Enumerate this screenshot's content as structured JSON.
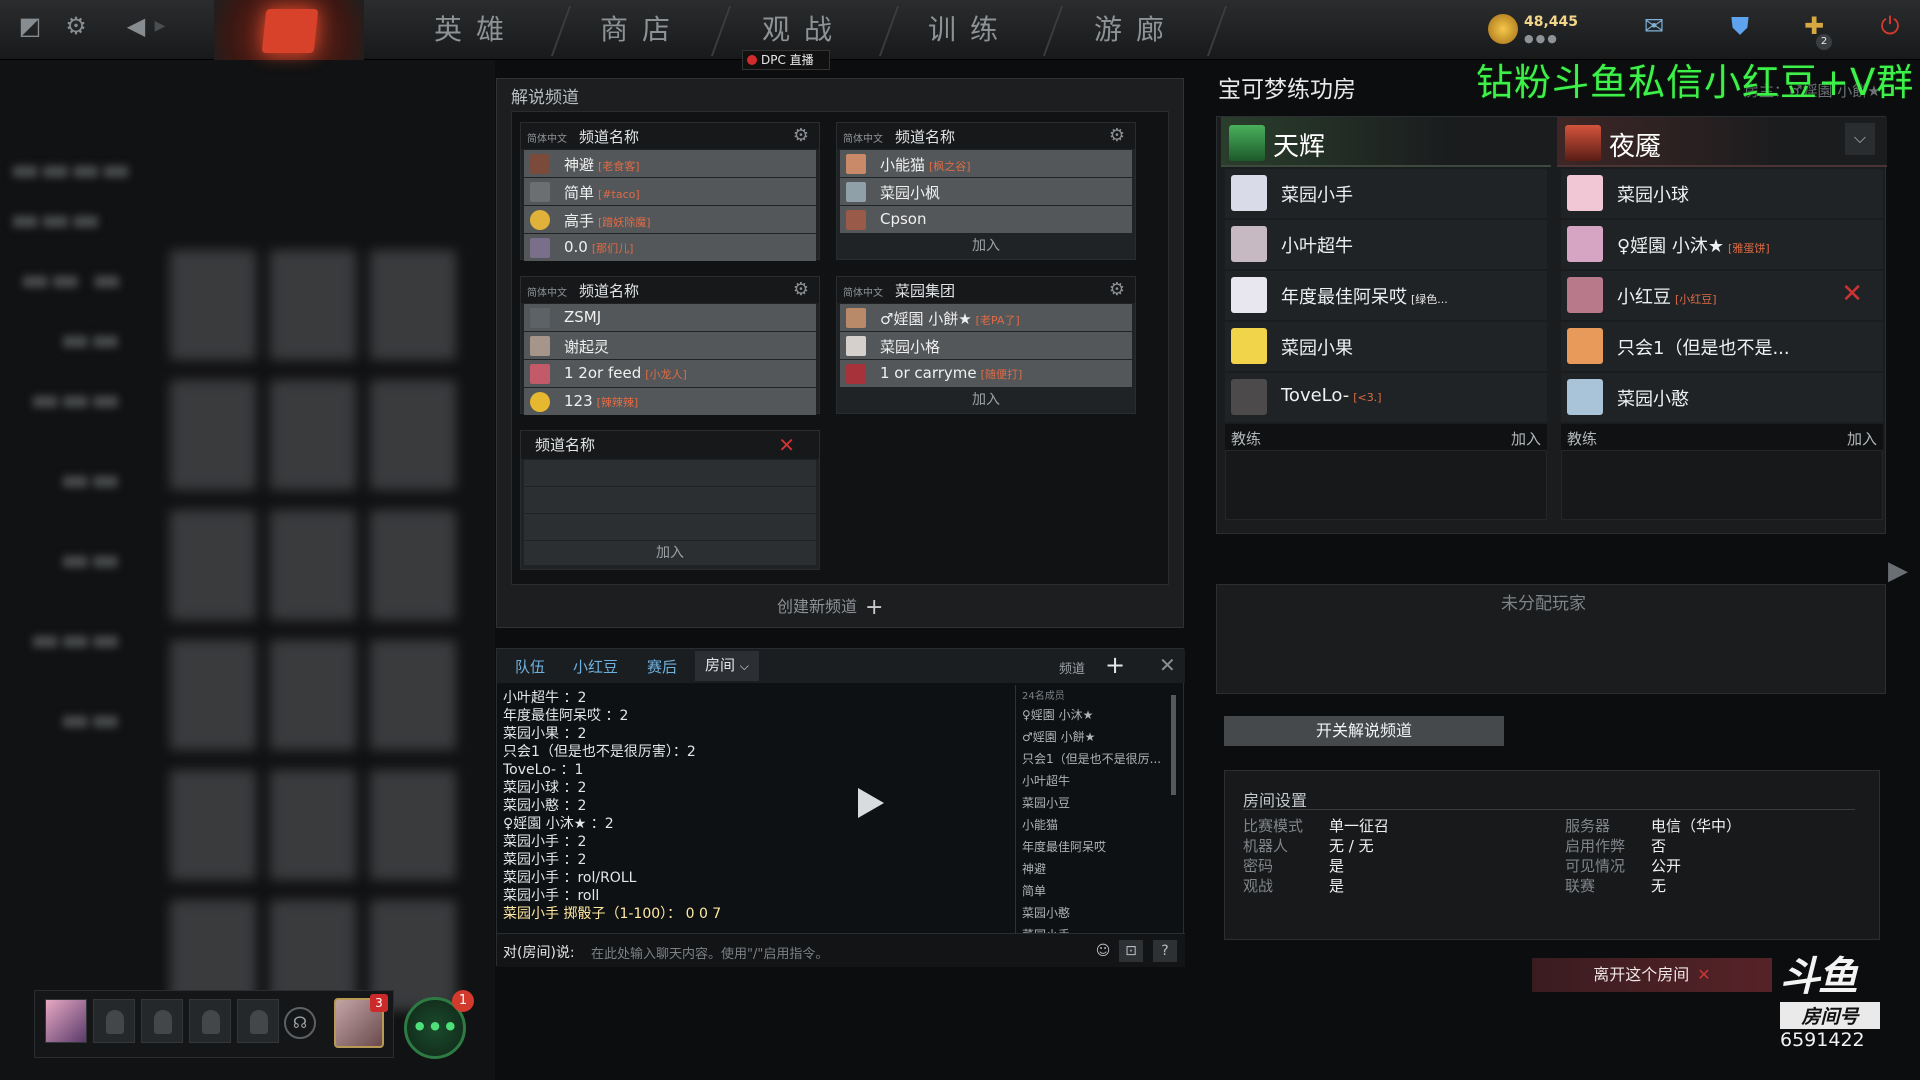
{
  "nav": {
    "heroes": "英雄",
    "store": "商店",
    "watch": "观战",
    "learn": "训练",
    "arcade": "游廊",
    "dpc_label": "DPC 直播"
  },
  "currency": {
    "amount": "48,445",
    "dots": "●●●"
  },
  "notifications": {
    "plus_badge": "2"
  },
  "commentary": {
    "title": "解说频道",
    "channels": [
      {
        "lang": "简体中文",
        "name": "频道名称",
        "players": [
          {
            "name": "神避",
            "tag": "[老食客]"
          },
          {
            "name": "简单",
            "tag": "[#taco]"
          },
          {
            "name": "高手",
            "tag": "[蹭妖除魔]"
          },
          {
            "name": "0.0",
            "tag": "[那们儿]"
          }
        ]
      },
      {
        "lang": "简体中文",
        "name": "频道名称",
        "players": [
          {
            "name": "小能猫",
            "tag": "[枫之谷]"
          },
          {
            "name": "菜园小枫",
            "tag": ""
          },
          {
            "name": "Cpson",
            "tag": ""
          }
        ],
        "join": "加入"
      },
      {
        "lang": "简体中文",
        "name": "频道名称",
        "players": [
          {
            "name": "ZSMJ",
            "tag": ""
          },
          {
            "name": "谢起灵",
            "tag": ""
          },
          {
            "name": "1 2or feed",
            "tag": "[小龙人]"
          },
          {
            "name": "123",
            "tag": "[辣辣辣]"
          }
        ]
      },
      {
        "lang": "简体中文",
        "name": "菜园集团",
        "players": [
          {
            "name": "♂婬園 小餅★",
            "tag": "[老PA了]"
          },
          {
            "name": "菜园小格",
            "tag": ""
          },
          {
            "name": "1 or carryme",
            "tag": "[随便打]"
          }
        ],
        "join": "加入"
      },
      {
        "lang": "",
        "name": "频道名称",
        "players": [],
        "join": "加入"
      }
    ],
    "create_label": "创建新频道",
    "create_plus": "+"
  },
  "chat": {
    "tabs": [
      "队伍",
      "小红豆",
      "赛后",
      "房间"
    ],
    "active_tab_arrow": "⌵",
    "channel_label": "频道",
    "plus": "+",
    "close": "✕",
    "messages": [
      "小叶超牛 ：2",
      "年度最佳阿呆哎 ：2",
      "菜园小果 ：2",
      "只会1（但是也不是很厉害）：2",
      "ToveLo- ：1",
      "菜园小球 ：2",
      "菜园小憨 ：2",
      "♀婬園 小沐★ ：2",
      "菜园小手 ：2",
      "菜园小手 ：2",
      "菜园小手 ：rol/ROLL",
      "菜园小手 ：roll"
    ],
    "roll_line": "菜园小手 掷骰子（1-100）：  0 0 7",
    "members_header": "24名成员",
    "members": [
      "♀婬園 小沐★",
      "♂婬園 小餅★",
      "只会1（但是也不是很厉...",
      "小叶超牛",
      "菜园小豆",
      "小能猫",
      "年度最佳阿呆哎",
      "神避",
      "简单",
      "菜园小憨",
      "菜园小手"
    ],
    "input_label": "对(房间)说:",
    "input_placeholder": "在此处输入聊天内容。使用\"/\"启用指令。",
    "help": "?"
  },
  "lobby": {
    "title": "宝可梦练功房",
    "watermark": "钻粉斗鱼私信小红豆+V群",
    "host_line": "房主：♂婬園 小餅★",
    "radiant": {
      "name": "天辉",
      "players": [
        {
          "name": "菜园小手",
          "tag": ""
        },
        {
          "name": "小叶超牛",
          "tag": ""
        },
        {
          "name": "年度最佳阿呆哎",
          "tag": "[绿色..."
        },
        {
          "name": "菜园小果",
          "tag": ""
        },
        {
          "name": "ToveLo-",
          "tag": "[<3.]"
        }
      ],
      "coach": "教练",
      "join": "加入"
    },
    "dire": {
      "name": "夜魇",
      "players": [
        {
          "name": "菜园小球",
          "tag": ""
        },
        {
          "name": "♀婬園 小沐★",
          "tag": "[雅蛋饼]"
        },
        {
          "name": "小红豆",
          "tag": "[小红豆]"
        },
        {
          "name": "只会1（但是也不是...",
          "tag": ""
        },
        {
          "name": "菜园小憨",
          "tag": ""
        }
      ],
      "coach": "教练",
      "join": "加入",
      "kick": "✕",
      "dropdown": "⌵"
    },
    "unassigned": "未分配玩家",
    "toggle_commentary": "开关解说频道",
    "settings": {
      "title": "房间设置",
      "left": [
        {
          "k": "比赛模式",
          "v": "单一征召"
        },
        {
          "k": "机器人",
          "v": "无 / 无"
        },
        {
          "k": "密码",
          "v": "是"
        },
        {
          "k": "观战",
          "v": "是"
        }
      ],
      "right": [
        {
          "k": "服务器",
          "v": "电信（华中）"
        },
        {
          "k": "启用作弊",
          "v": "否"
        },
        {
          "k": "可见情况",
          "v": "公开"
        },
        {
          "k": "联赛",
          "v": "无"
        }
      ]
    },
    "leave": "离开这个房间",
    "leave_x": "✕"
  },
  "stream": {
    "brand": "斗鱼",
    "room_label": "房间号",
    "room_number": "6591422"
  },
  "party": {
    "friend_badge": "3",
    "chat_badge": "1"
  }
}
